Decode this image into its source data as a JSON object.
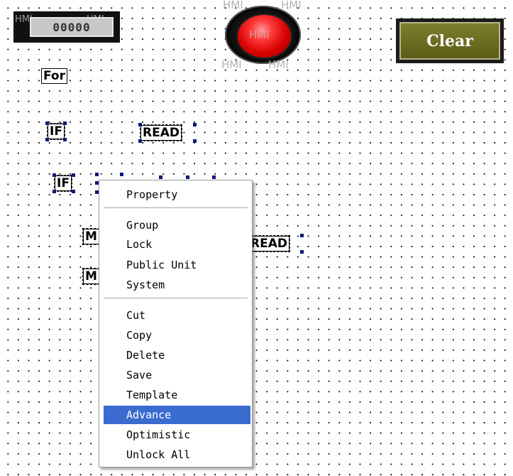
{
  "numeric_display": {
    "value": "00000",
    "ghost_left": "HMI",
    "ghost_right": "HMI"
  },
  "lamp": {
    "hmi_labels": [
      "HMI",
      "HMI",
      "HMI",
      "HMI",
      "HMI"
    ],
    "color": "#e00000"
  },
  "clear_button": {
    "label": "Clear"
  },
  "canvas_labels": {
    "for": "For",
    "if1": "IF",
    "read1": "READ",
    "if2": "IF",
    "m1": "M",
    "read2": "READ",
    "m2": "M"
  },
  "context_menu": {
    "items": [
      "Property",
      "Group",
      "Lock",
      "Public Unit",
      "System",
      "Cut",
      "Copy",
      "Delete",
      "Save",
      "Template",
      "Advance",
      "Optimistic",
      "Unlock All"
    ],
    "highlighted": "Advance",
    "highlight_color": "#3a6ccf"
  }
}
